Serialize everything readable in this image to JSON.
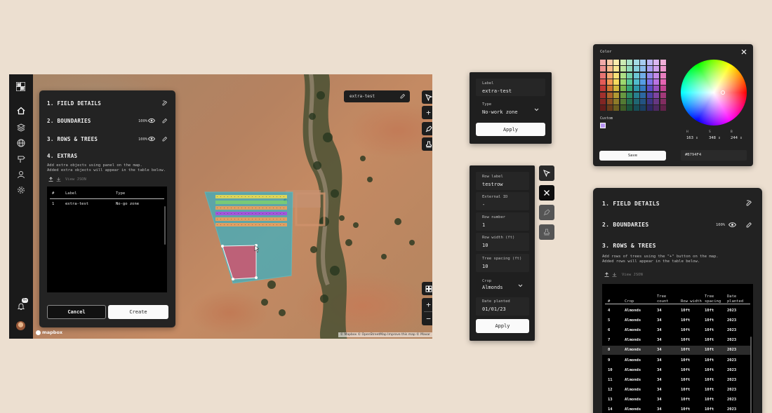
{
  "app": {
    "sidebar": {
      "items": [
        {
          "icon": "home-icon"
        },
        {
          "icon": "layers-icon"
        },
        {
          "icon": "globe-icon"
        },
        {
          "icon": "signpost-icon"
        },
        {
          "icon": "user-icon"
        },
        {
          "icon": "gear-icon"
        }
      ],
      "notification_count": "9+"
    },
    "panel": {
      "sections": [
        {
          "label": "1. FIELD DETAILS"
        },
        {
          "label": "2. BOUNDARIES",
          "opacity": "100%"
        },
        {
          "label": "3. ROWS & TREES",
          "opacity": "100%"
        },
        {
          "label": "4. EXTRAS"
        }
      ],
      "extras_help": "Add extra objects using panel on the map.\nAdded extra objects will appear in the table below.",
      "view_json": "View JSON",
      "table": {
        "headers": [
          "#",
          "Label",
          "Type"
        ],
        "rows": [
          {
            "num": "1",
            "label": "extra-test",
            "type": "No-go zone"
          }
        ]
      },
      "cancel_label": "Cancel",
      "create_label": "Create"
    },
    "map": {
      "label_chip": "extra-test",
      "attribution": "© Mapbox © OpenStreetMap  Improve this map  © Maxar",
      "mapbox_logo": "mapbox",
      "plus": "+",
      "minus": "−"
    }
  },
  "extra_form": {
    "label_title": "Label",
    "label_value": "extra-test",
    "type_title": "Type",
    "type_value": "No-work zone",
    "apply": "Apply"
  },
  "row_form": {
    "fields": [
      {
        "title": "Row label",
        "value": "testrow"
      },
      {
        "title": "External ID",
        "value": "-"
      },
      {
        "title": "Row number",
        "value": "1"
      },
      {
        "title": "Row width (ft)",
        "value": "10"
      },
      {
        "title": "Tree spacing (ft)",
        "value": "10"
      }
    ],
    "crop_title": "Crop",
    "crop_value": "Almonds",
    "date_title": "Date planted",
    "date_value": "01/01/23",
    "apply": "Apply"
  },
  "color_picker": {
    "title": "Color",
    "custom_label": "Custom",
    "custom_color": "#B794F4",
    "hsl_labels": [
      "H",
      "S",
      "B"
    ],
    "hsl_values": [
      "163",
      "348",
      "244"
    ],
    "save": "Save",
    "hex_value": "#B794F4"
  },
  "rows_panel": {
    "sections": [
      {
        "label": "1. FIELD DETAILS"
      },
      {
        "label": "2. BOUNDARIES",
        "opacity": "100%"
      },
      {
        "label": "3. ROWS & TREES"
      }
    ],
    "help": "Add rows of trees using the \"+\" button on the map.\nAdded rows will appear in the table below.",
    "view_json": "View JSON",
    "headers": [
      "#",
      "Crop",
      "Tree count",
      "Row width",
      "Tree spacing",
      "Date planted"
    ],
    "rows": [
      {
        "n": "4",
        "crop": "Almonds",
        "count": "34",
        "width": "10ft",
        "spacing": "10ft",
        "date": "2023"
      },
      {
        "n": "5",
        "crop": "Almonds",
        "count": "34",
        "width": "10ft",
        "spacing": "10ft",
        "date": "2023"
      },
      {
        "n": "6",
        "crop": "Almonds",
        "count": "34",
        "width": "10ft",
        "spacing": "10ft",
        "date": "2023"
      },
      {
        "n": "7",
        "crop": "Almonds",
        "count": "34",
        "width": "10ft",
        "spacing": "10ft",
        "date": "2023"
      },
      {
        "n": "8",
        "crop": "Almonds",
        "count": "34",
        "width": "10ft",
        "spacing": "10ft",
        "date": "2023"
      },
      {
        "n": "9",
        "crop": "Almonds",
        "count": "34",
        "width": "10ft",
        "spacing": "10ft",
        "date": "2023"
      },
      {
        "n": "10",
        "crop": "Almonds",
        "count": "34",
        "width": "10ft",
        "spacing": "10ft",
        "date": "2023"
      },
      {
        "n": "11",
        "crop": "Almonds",
        "count": "34",
        "width": "10ft",
        "spacing": "10ft",
        "date": "2023"
      },
      {
        "n": "12",
        "crop": "Almonds",
        "count": "34",
        "width": "10ft",
        "spacing": "10ft",
        "date": "2023"
      },
      {
        "n": "13",
        "crop": "Almonds",
        "count": "34",
        "width": "10ft",
        "spacing": "10ft",
        "date": "2023"
      },
      {
        "n": "14",
        "crop": "Almonds",
        "count": "34",
        "width": "10ft",
        "spacing": "10ft",
        "date": "2023"
      }
    ],
    "selected_row": "8"
  },
  "colors": {
    "page_bg": "#ecdfd0",
    "panel_bg": "#232323",
    "zone_fill": "#36b2c6",
    "nogo_fill": "#c85a73",
    "accent": "#B794F4"
  }
}
